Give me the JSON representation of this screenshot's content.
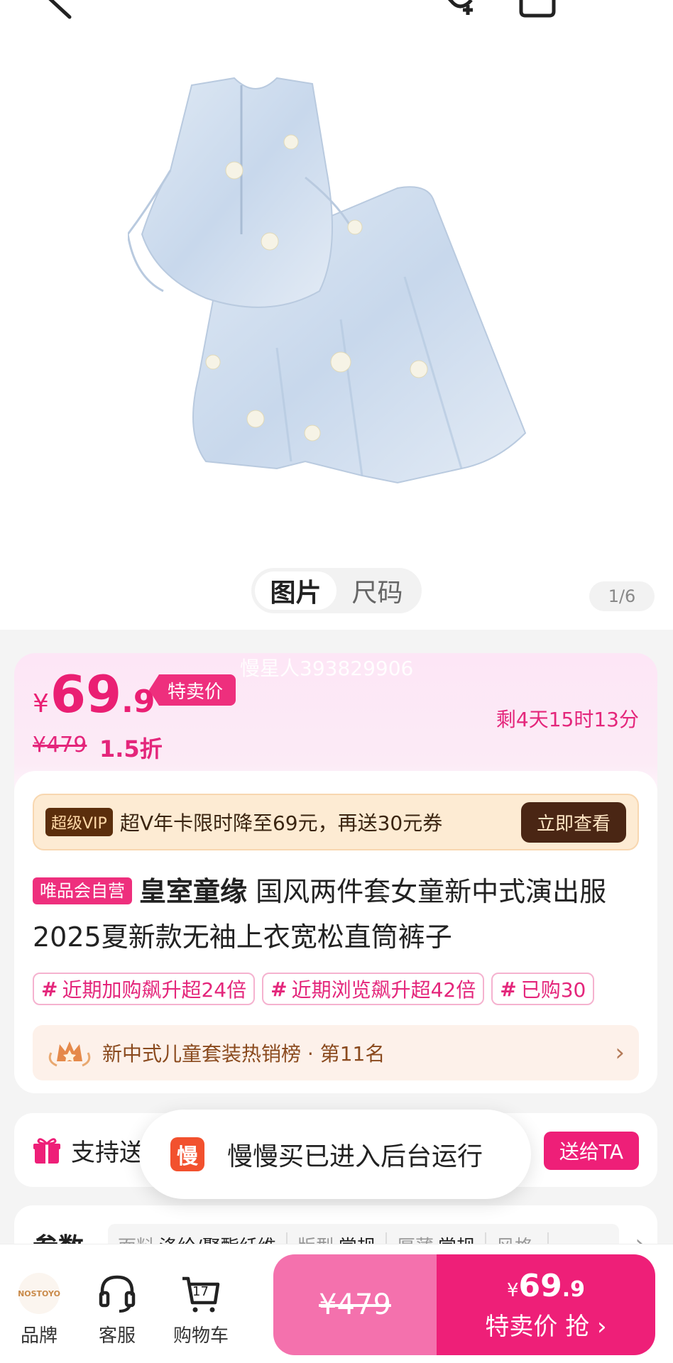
{
  "media": {
    "tabs": [
      "图片",
      "尺码"
    ],
    "pager": "1/6"
  },
  "price": {
    "watermark": "慢星人393829906",
    "currency": "¥",
    "integer": "69",
    "decimal": ".9",
    "badge": "特卖价",
    "countdown": "剩4天15时13分",
    "original": "¥479",
    "discount": "1.5折"
  },
  "vip": {
    "tag": "超级VIP",
    "text": "超V年卡限时降至69元，再送30元券",
    "button": "立即查看"
  },
  "product": {
    "self_tag": "唯品会自营",
    "brand": "皇室童缘",
    "title": "国风两件套女童新中式演出服2025夏新款无袖上衣宽松直筒裤子",
    "tags": [
      "近期加购飙升超24倍",
      "近期浏览飙升超42倍",
      "已购30"
    ],
    "rank": "新中式儿童套装热销榜 · 第11名"
  },
  "gift": {
    "label": "支持送",
    "button": "送给TA"
  },
  "toast": {
    "logo": "慢",
    "text": "慢慢买已进入后台运行"
  },
  "params": {
    "title": "参数",
    "items": [
      {
        "key": "面料",
        "value": "涤纶/聚酯纤维"
      },
      {
        "key": "版型",
        "value": "常规"
      },
      {
        "key": "厚薄",
        "value": "常规"
      },
      {
        "key": "风格",
        "value": ""
      }
    ]
  },
  "bottom": {
    "brand_label": "品牌",
    "brand_logo": "NOSTOYO",
    "service_label": "客服",
    "cart_label": "购物车",
    "cart_count": "17",
    "buy_original": "¥479",
    "buy_currency": "¥",
    "buy_integer": "69",
    "buy_decimal": ".9",
    "buy_label": "特卖价 抢 ›"
  },
  "colors": {
    "accent": "#ee1f78",
    "accent_light": "#f471ad",
    "vip_dark": "#4a2614",
    "vip_bg": "#fdebd3"
  }
}
